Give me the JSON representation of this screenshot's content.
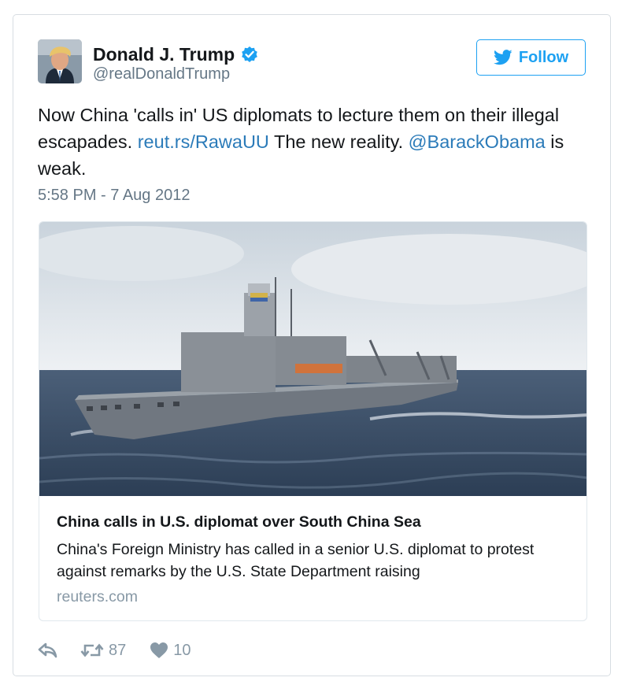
{
  "tweet": {
    "author_name": "Donald J. Trump",
    "author_handle": "@realDonaldTrump",
    "follow_label": "Follow",
    "text_parts": {
      "p1": "Now China 'calls in' US diplomats to lecture them on their illegal escapades. ",
      "link": "reut.rs/RawaUU",
      "p2": " The new reality. ",
      "mention": "@BarackObama",
      "p3": " is weak."
    },
    "timestamp": "5:58 PM - 7 Aug 2012",
    "card": {
      "title": "China calls in U.S. diplomat over South China Sea",
      "description": "China's Foreign Ministry has called in a senior U.S. diplomat to protest against remarks by the U.S. State Department raising",
      "domain": "reuters.com"
    },
    "actions": {
      "retweet_count": "87",
      "like_count": "10"
    }
  },
  "colors": {
    "accent": "#1da1f2",
    "link": "#2b7bb9",
    "muted": "#657786",
    "border": "#d7dde2"
  },
  "icons": [
    "verified-badge-icon",
    "twitter-bird-icon",
    "reply-icon",
    "retweet-icon",
    "heart-icon"
  ]
}
